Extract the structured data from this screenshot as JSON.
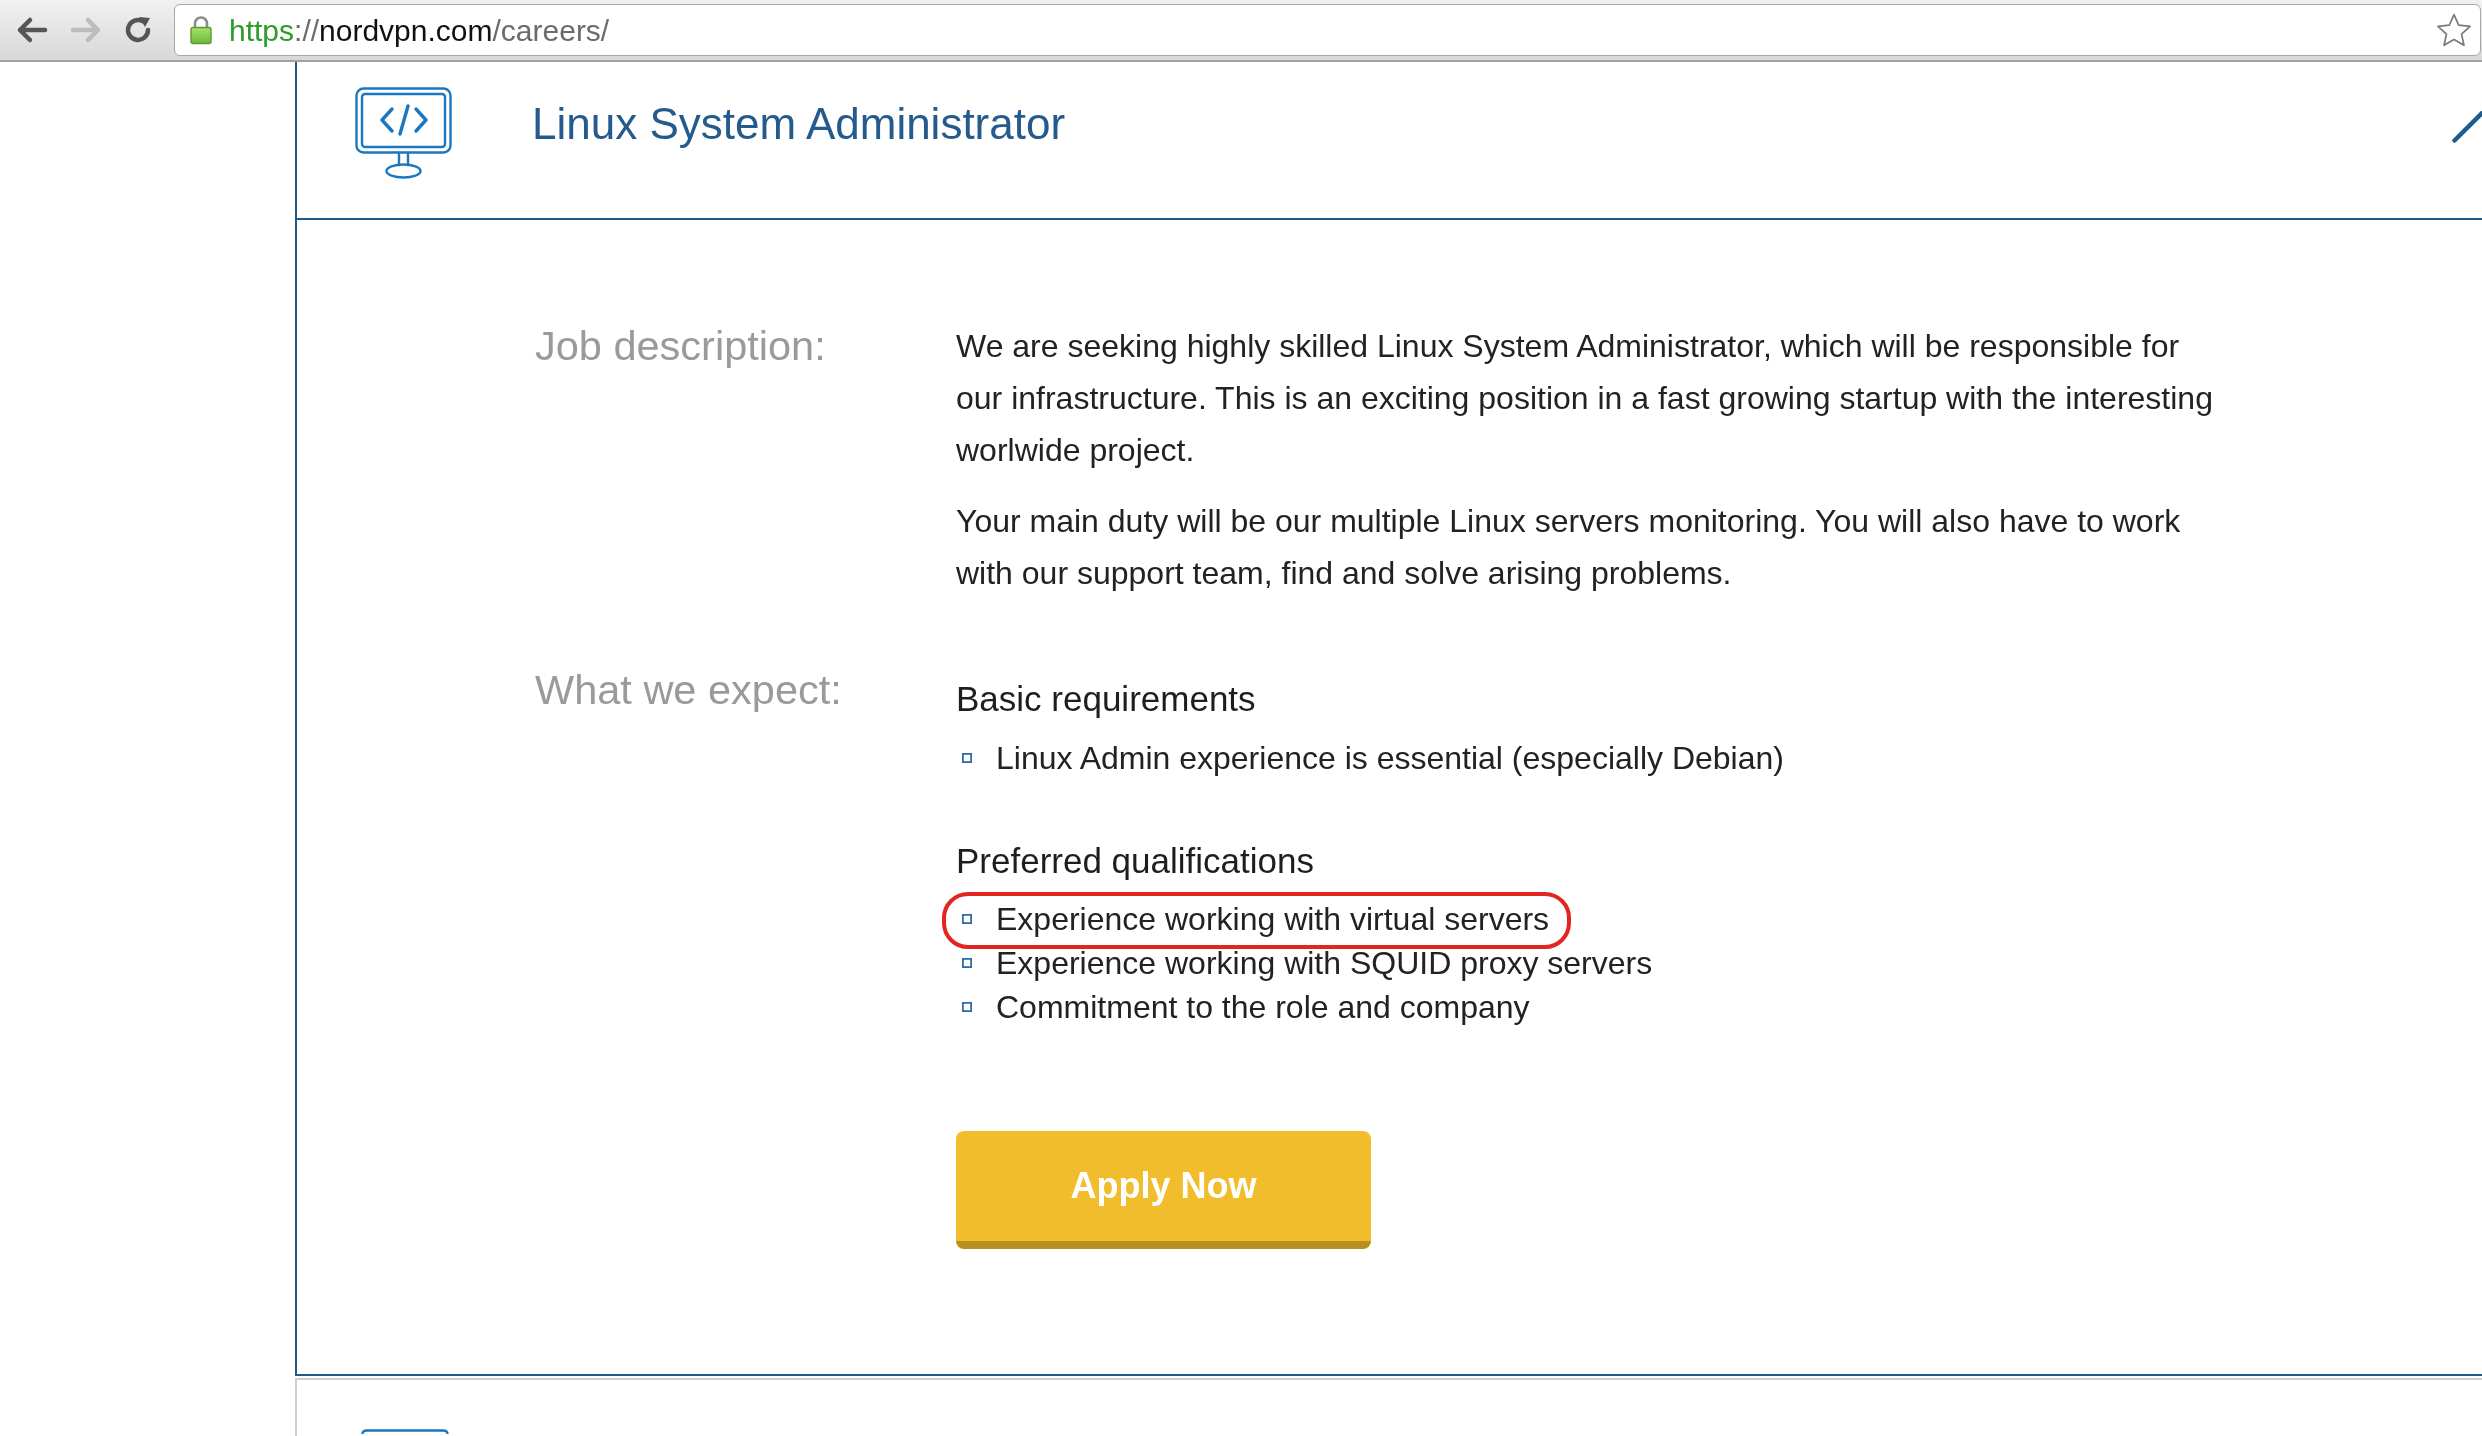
{
  "browser": {
    "nav_buttons": [
      {
        "kind": "back",
        "disabled": false
      },
      {
        "kind": "forward",
        "disabled": true
      },
      {
        "kind": "reload",
        "disabled": false
      }
    ],
    "address_bar": {
      "secure": true,
      "url_parts": [
        {
          "kind": "scheme",
          "text": "https"
        },
        {
          "kind": "separator",
          "text": "://"
        },
        {
          "kind": "host",
          "text": "nordvpn.com"
        },
        {
          "kind": "path",
          "text": "/careers/"
        }
      ],
      "bookmarked": false
    }
  },
  "job": {
    "title": "Linux System Administrator",
    "sections": [
      {
        "kind": "paragraphs",
        "label": "Job description:",
        "paragraphs": [
          "We are seeking highly skilled Linux System Administrator, which will be responsible for our infrastructure. This is an exciting position in a fast growing startup with the interesting worlwide project.",
          "Your main duty will be our multiple Linux servers monitoring. You will also have to work with our support team, find and solve arising problems."
        ]
      },
      {
        "kind": "requirements",
        "label": "What we expect:",
        "groups": [
          {
            "heading": "Basic requirements",
            "items": [
              {
                "text": "Linux Admin experience is essential (especially Debian)",
                "highlighted": false
              }
            ]
          },
          {
            "heading": "Preferred qualifications",
            "items": [
              {
                "text": "Experience working with virtual servers",
                "highlighted": true
              },
              {
                "text": "Experience working with SQUID proxy servers",
                "highlighted": false
              },
              {
                "text": "Commitment to the role and company",
                "highlighted": false
              }
            ]
          }
        ]
      }
    ],
    "apply_button": {
      "label": "Apply Now"
    }
  }
}
